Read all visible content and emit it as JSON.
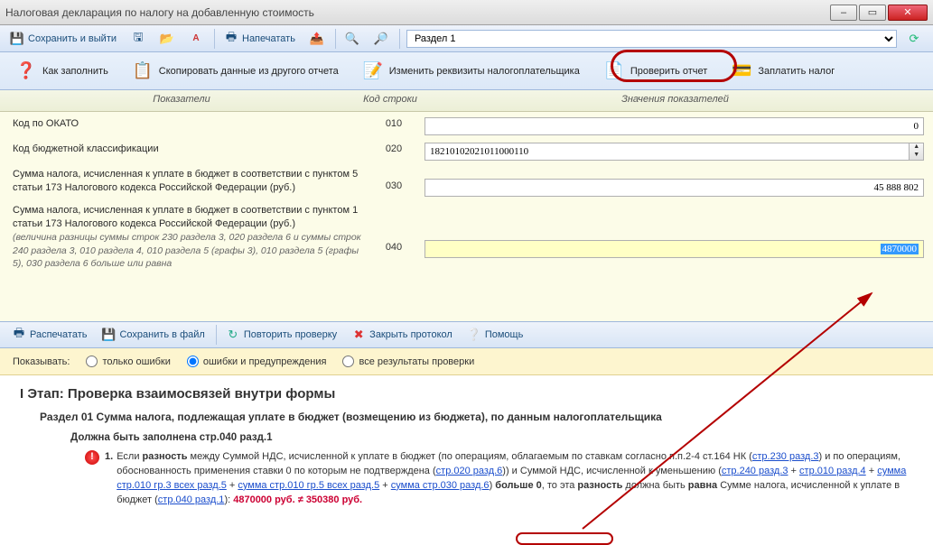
{
  "window": {
    "title": "Налоговая декларация по налогу на добавленную стоимость"
  },
  "toolbar1": {
    "save_exit": "Сохранить и выйти",
    "print": "Напечатать",
    "section_selector": "Раздел 1"
  },
  "bigbar": {
    "how_fill": "Как заполнить",
    "copy": "Скопировать данные из другого отчета",
    "change_req": "Изменить реквизиты налогоплательщика",
    "check": "Проверить отчет",
    "pay": "Заплатить налог"
  },
  "grid": {
    "hdr_ind": "Показатели",
    "hdr_code": "Код строки",
    "hdr_val": "Значения показателей",
    "rows": [
      {
        "label": "Код по ОКАТО",
        "code": "010",
        "value": "0",
        "align": "right"
      },
      {
        "label": "Код бюджетной классификации",
        "code": "020",
        "value": "18210102021011000110",
        "align": "left"
      },
      {
        "label": "Сумма налога, исчисленная к уплате в бюджет в соответствии с пунктом 5 статьи 173 Налогового кодекса Российской Федерации (руб.)",
        "code": "030",
        "value": "45 888 802",
        "align": "right"
      },
      {
        "label": "Сумма налога, исчисленная к уплате в бюджет в соответствии с пунктом 1 статьи 173 Налогового кодекса Российской Федерации (руб.)",
        "note": "(величина разницы суммы строк 230 раздела 3, 020 раздела 6 и суммы строк 240 раздела 3, 010 раздела 4, 010 раздела 5 (графы 3), 010 раздела 5 (графы 5), 030 раздела 6 больше или равна",
        "code": "040",
        "value": "4870000",
        "align": "right",
        "highlight": true
      }
    ]
  },
  "lowerbar": {
    "print": "Распечатать",
    "save_file": "Сохранить в файл",
    "repeat": "Повторить проверку",
    "close_proto": "Закрыть протокол",
    "help": "Помощь"
  },
  "filter": {
    "label": "Показывать:",
    "opt_errors": "только ошибки",
    "opt_warn": "ошибки и предупреждения",
    "opt_all": "все результаты проверки"
  },
  "results": {
    "h1": "I Этап: Проверка взаимосвязей внутри формы",
    "h2": "Раздел 01 Сумма налога, подлежащая уплате в бюджет (возмещению из бюджета), по данным налогоплательщика",
    "h3": "Должна быть заполнена стр.040 разд.1",
    "item_num": "1.",
    "item_pre": "Если ",
    "item_bold1": "разность",
    "item_t1": " между Суммой НДС, исчисленной к уплате в бюджет (по операциям, облагаемым по ставкам согласно п.п.2-4 ст.164 НК (",
    "l1": "стр.230 разд.3",
    "item_t2": ") и по операциям, обоснованность применения ставки 0 по которым не подтверждена (",
    "l2": "стр.020 разд.6",
    "item_t3": ")) и Суммой НДС, исчисленной к уменьшению (",
    "l3": "стр.240 разд.3",
    "plus": " + ",
    "l4": "стр.010 разд.4",
    "l5": "сумма стр.010 гр.3 всех разд.5",
    "l6": "сумма стр.010 гр.5 всех разд.5",
    "l7": "сумма стр.030 разд.6",
    "item_t4": ") ",
    "bold2": "больше 0",
    "item_t5": ", то эта ",
    "bold3": "разность",
    "item_t6": " должна быть ",
    "bold4": "равна",
    "item_t7": " Сумме налога, исчисленной к уплате в бюджет (",
    "l8": "стр.040 разд.1",
    "item_t8": "): ",
    "val1": "4870000 руб.",
    "neq": " ≠ ",
    "val2": "350380 руб."
  }
}
